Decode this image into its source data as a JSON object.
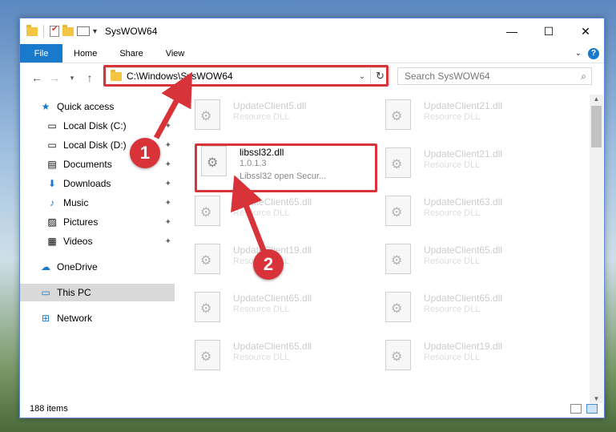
{
  "window": {
    "title": "SysWOW64",
    "controls": {
      "minimize": "—",
      "maximize": "☐",
      "close": "✕"
    }
  },
  "ribbon": {
    "file": "File",
    "tabs": [
      "Home",
      "Share",
      "View"
    ]
  },
  "address": {
    "path": "C:\\Windows\\SysWOW64",
    "search_placeholder": "Search SysWOW64"
  },
  "sidebar": {
    "items": [
      {
        "label": "Quick access",
        "icon": "star-icon"
      },
      {
        "label": "Local Disk (C:)",
        "icon": "drive-icon"
      },
      {
        "label": "Local Disk (D:)",
        "icon": "drive-icon"
      },
      {
        "label": "Documents",
        "icon": "documents-icon"
      },
      {
        "label": "Downloads",
        "icon": "download-icon"
      },
      {
        "label": "Music",
        "icon": "music-icon"
      },
      {
        "label": "Pictures",
        "icon": "pictures-icon"
      },
      {
        "label": "Videos",
        "icon": "videos-icon"
      },
      {
        "label": "OneDrive",
        "icon": "cloud-icon"
      },
      {
        "label": "This PC",
        "icon": "pc-icon"
      },
      {
        "label": "Network",
        "icon": "network-icon"
      }
    ]
  },
  "files": {
    "active": {
      "name": "libssl32.dll",
      "version": "1.0.1.3",
      "desc": "Libssl32 open Secur..."
    },
    "left": [
      {
        "name": "UpdateClient5.dll",
        "desc": "Resource DLL"
      },
      {
        "name": "UpdateClient65.dll",
        "desc": "Resource DLL"
      },
      {
        "name": "UpdateClient19.dll",
        "desc": "Resource DLL"
      },
      {
        "name": "UpdateClient65.dll",
        "desc": "Resource DLL"
      },
      {
        "name": "UpdateClient65.dll",
        "desc": "Resource DLL"
      }
    ],
    "right": [
      {
        "name": "UpdateClient21.dll",
        "desc": "Resource DLL"
      },
      {
        "name": "UpdateClient21.dll",
        "desc": "Resource DLL"
      },
      {
        "name": "UpdateClient63.dll",
        "desc": "Resource DLL"
      },
      {
        "name": "UpdateClient65.dll",
        "desc": "Resource DLL"
      },
      {
        "name": "UpdateClient65.dll",
        "desc": "Resource DLL"
      },
      {
        "name": "UpdateClient19.dll",
        "desc": "Resource DLL"
      },
      {
        "name": "UpdateClient65.dll",
        "desc": "Resource DLL"
      }
    ]
  },
  "status": {
    "count": "188 items"
  },
  "callouts": [
    "1",
    "2"
  ],
  "colors": {
    "accent": "#1979ca",
    "highlight": "#d9333a"
  }
}
